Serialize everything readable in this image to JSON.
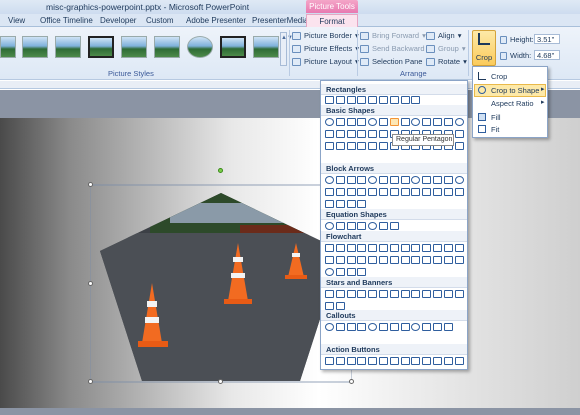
{
  "window": {
    "title": "misc-graphics-powerpoint.pptx - Microsoft PowerPoint",
    "context_tab": "Picture Tools"
  },
  "tabs": [
    "View",
    "Office Timeline",
    "Developer",
    "Custom",
    "Adobe Presenter",
    "PresenterMedia",
    "Format"
  ],
  "ribbon": {
    "picture_styles_label": "Picture Styles",
    "arrange_label": "Arrange",
    "picture_border": "Picture Border",
    "picture_effects": "Picture Effects",
    "picture_layout": "Picture Layout",
    "bring_forward": "Bring Forward",
    "send_backward": "Send Backward",
    "selection_pane": "Selection Pane",
    "align": "Align",
    "group": "Group",
    "rotate": "Rotate",
    "crop": "Crop",
    "height_label": "Height:",
    "height_value": "3.51\"",
    "width_label": "Width:",
    "width_value": "4.68\""
  },
  "crop_menu": [
    "Crop",
    "Crop to Shape",
    "Aspect Ratio",
    "Fill",
    "Fit"
  ],
  "gallery": {
    "sections": [
      "Rectangles",
      "Basic Shapes",
      "Block Arrows",
      "Equation Shapes",
      "Flowchart",
      "Stars and Banners",
      "Callouts",
      "Action Buttons"
    ],
    "tooltip": "Regular Pentagon"
  },
  "icons": [
    "picture-border-icon",
    "picture-effects-icon",
    "picture-layout-icon",
    "bring-forward-icon",
    "send-backward-icon",
    "selection-pane-icon",
    "align-icon",
    "group-icon",
    "rotate-icon",
    "crop-icon"
  ],
  "colors": {
    "accent": "#e879b0",
    "highlight": "#fbcb5b",
    "ribbon": "#dde8f5"
  }
}
